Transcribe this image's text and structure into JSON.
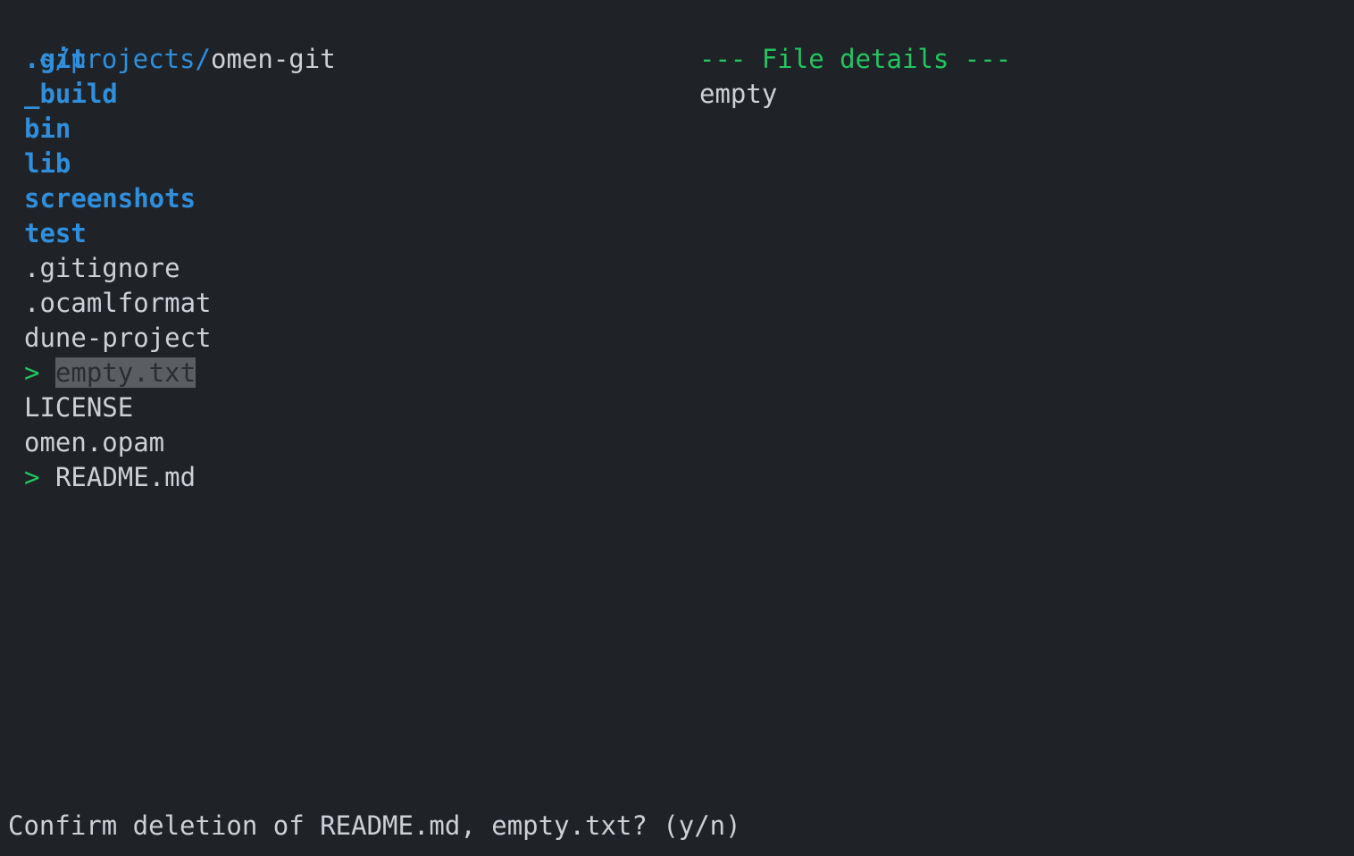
{
  "header": {
    "path_prefix": "~/projects/",
    "path_current": "omen-git"
  },
  "entries": {
    "items": [
      {
        "name": ".git"
      },
      {
        "name": "_build"
      },
      {
        "name": "bin"
      },
      {
        "name": "lib"
      },
      {
        "name": "screenshots"
      },
      {
        "name": "test"
      },
      {
        "name": ".gitignore"
      },
      {
        "name": ".ocamlformat"
      },
      {
        "name": "dune-project"
      },
      {
        "name": "empty.txt",
        "marker": ">"
      },
      {
        "name": "LICENSE"
      },
      {
        "name": "omen.opam"
      },
      {
        "name": "README.md",
        "marker": ">"
      }
    ]
  },
  "details": {
    "header": "--- File details ---",
    "body": "empty"
  },
  "prompt": {
    "text": "Confirm deletion of README.md, empty.txt? (y/n)"
  },
  "colors": {
    "background": "#1f2328",
    "directory": "#2f8fdd",
    "marker": "#22c55e",
    "text": "#cdd0d5",
    "cursor_bg": "#5a5e62"
  }
}
